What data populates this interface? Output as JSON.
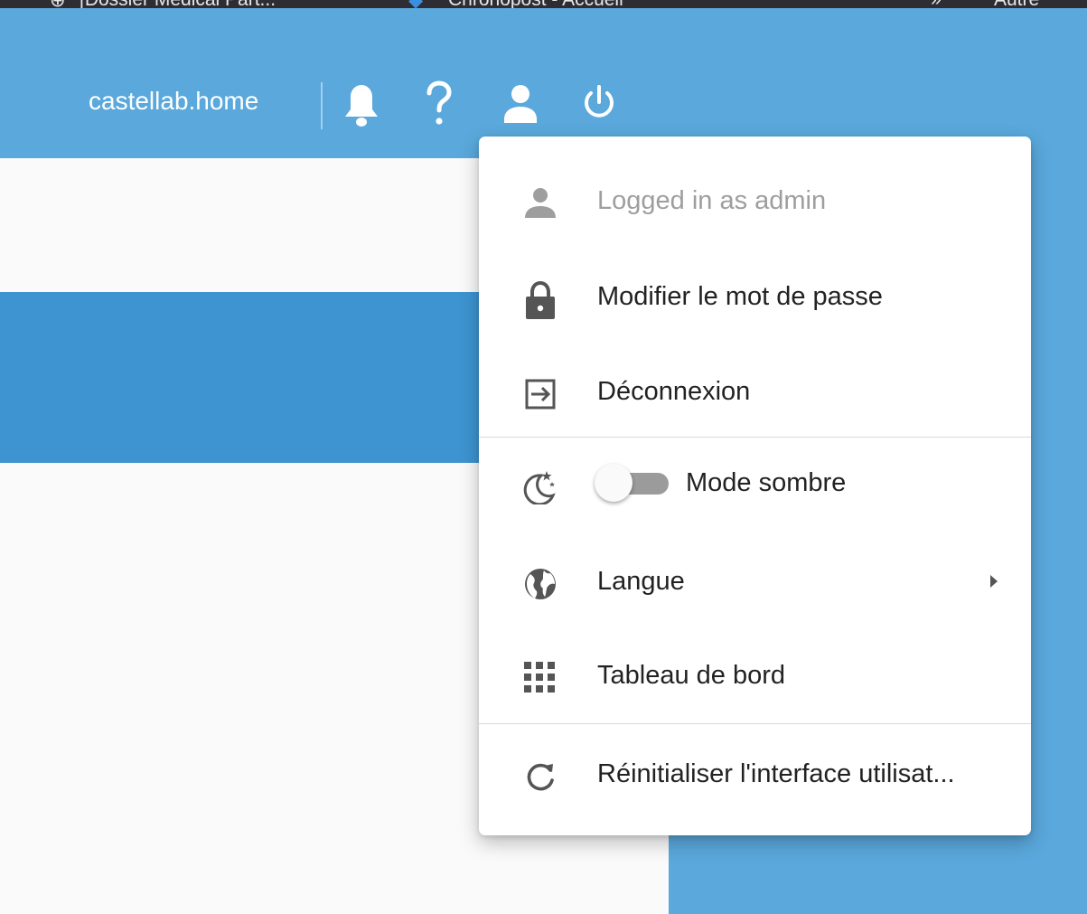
{
  "browser": {
    "bookmarks": [
      "[Dossier Médical Part...",
      "Chronopost - Accueil",
      "Autre"
    ],
    "overflow_glyph": "»"
  },
  "header": {
    "host": "castellab.home",
    "icons": [
      "bell-icon",
      "help-icon",
      "user-icon",
      "power-icon"
    ]
  },
  "menu": {
    "logged_in": "Logged in as admin",
    "change_password": "Modifier le mot de passe",
    "logout": "Déconnexion",
    "dark_mode": "Mode sombre",
    "dark_mode_on": false,
    "language": "Langue",
    "dashboard": "Tableau de bord",
    "reset_ui": "Réinitialiser l'interface utilisat..."
  },
  "colors": {
    "header": "#5aa8dc",
    "accent_bar": "#3d94d0",
    "text": "#222222",
    "muted": "#9e9e9e",
    "icon": "#555555"
  }
}
